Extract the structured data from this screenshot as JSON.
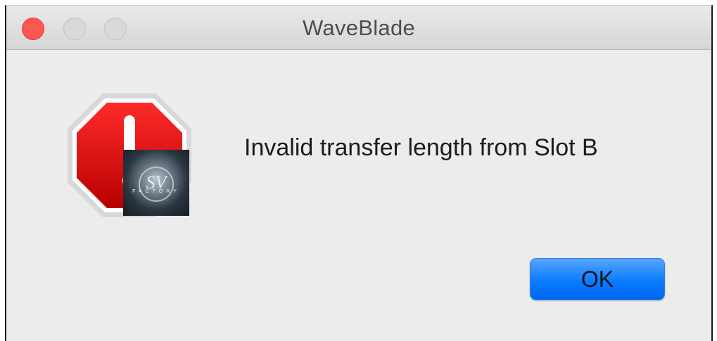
{
  "window": {
    "title": "WaveBlade",
    "controls": [
      "close",
      "minimize",
      "zoom"
    ]
  },
  "dialog": {
    "icon": "stop-alert-icon",
    "app_badge": "sv-factory-logo",
    "app_badge_text": "SV FACTORY",
    "message": "Invalid transfer length from Slot B",
    "ok_label": "OK"
  },
  "colors": {
    "close": "#fc5753",
    "button_accent": "#0a7bff",
    "stop_sign": "#e00000"
  }
}
